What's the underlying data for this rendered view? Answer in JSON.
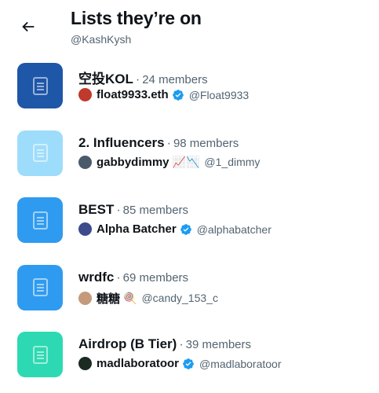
{
  "header": {
    "back_icon": "arrow-left-icon",
    "title": "Lists they’re on",
    "handle": "@KashKysh"
  },
  "lists": [
    {
      "name": "空投KOL",
      "members": "24 members",
      "tile_color": "#1e56a8",
      "owner": {
        "name": "float9933.eth",
        "verified": true,
        "emoji": "",
        "handle": "@Float9933",
        "avatar_color": "#c0392b"
      }
    },
    {
      "name": "2. Influencers",
      "members": "98 members",
      "tile_color": "#9edcfb",
      "owner": {
        "name": "gabbydimmy",
        "verified": false,
        "emoji": "📈📉",
        "handle": "@1_dimmy",
        "avatar_color": "#4a5a6a"
      }
    },
    {
      "name": "BEST",
      "members": "85 members",
      "tile_color": "#2f9bf0",
      "owner": {
        "name": "Alpha Batcher",
        "verified": true,
        "emoji": "",
        "handle": "@alphabatcher",
        "avatar_color": "#3b4b8c"
      }
    },
    {
      "name": "wrdfc",
      "members": "69 members",
      "tile_color": "#2f9bf0",
      "owner": {
        "name": "糖糖",
        "verified": false,
        "emoji": "🍭",
        "handle": "@candy_153_c",
        "avatar_color": "#c49a7a"
      }
    },
    {
      "name": "Airdrop (B Tier)",
      "members": "39 members",
      "tile_color": "#2dd9b2",
      "owner": {
        "name": "madlaboratoor",
        "verified": true,
        "emoji": "",
        "handle": "@madlaboratoor",
        "avatar_color": "#1b2b22"
      }
    }
  ],
  "colors": {
    "verified_badge": "#1d9bf0",
    "secondary_text": "#536471"
  }
}
